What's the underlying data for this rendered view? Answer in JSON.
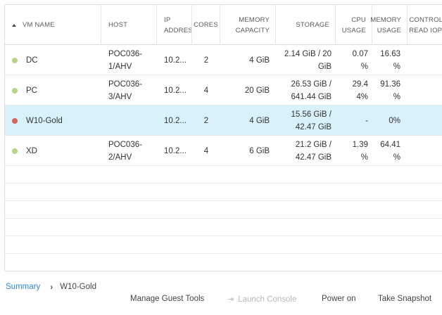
{
  "columns": {
    "vm_name": "VM NAME",
    "host": "HOST",
    "ip_1": "IP",
    "ip_2": "ADDRESS",
    "cores": "CORES",
    "memory_1": "MEMORY",
    "memory_2": "CAPACITY",
    "storage": "STORAGE",
    "cpu_1": "CPU",
    "cpu_2": "USAGE",
    "mem_usage_1": "MEMORY",
    "mem_usage_2": "USAGE",
    "ctrl_1": "CONTROLL",
    "ctrl_2": "READ IOPS"
  },
  "rows": [
    {
      "status_color": "#b5d38a",
      "name": "DC",
      "host_1": "POC036-",
      "host_2": "1/AHV",
      "ip": "10.2...",
      "cores": "2",
      "memory": "4 GiB",
      "storage_1": "2.14 GiB / 20",
      "storage_2": "GiB",
      "cpu_1": "0.07",
      "cpu_2": "%",
      "mem_1": "16.63",
      "mem_2": "%"
    },
    {
      "status_color": "#b5d38a",
      "name": "PC",
      "host_1": "POC036-",
      "host_2": "3/AHV",
      "ip": "10.2...",
      "cores": "4",
      "memory": "20 GiB",
      "storage_1": "26.53 GiB /",
      "storage_2": "641.44 GiB",
      "cpu_1": "29.4",
      "cpu_2": "4%",
      "mem_1": "91.36",
      "mem_2": "%"
    },
    {
      "status_color": "#d9625b",
      "name": "W10-Gold",
      "host_1": "",
      "host_2": "",
      "ip": "10.2...",
      "cores": "2",
      "memory": "4 GiB",
      "storage_1": "15.56 GiB /",
      "storage_2": "42.47 GiB",
      "cpu_1": "-",
      "cpu_2": "",
      "mem_1": "0%",
      "mem_2": ""
    },
    {
      "status_color": "#b5d38a",
      "name": "XD",
      "host_1": "POC036-",
      "host_2": "2/AHV",
      "ip": "10.2...",
      "cores": "4",
      "memory": "6 GiB",
      "storage_1": "21.2 GiB /",
      "storage_2": "42.47 GiB",
      "cpu_1": "1.39",
      "cpu_2": "%",
      "mem_1": "64.41",
      "mem_2": "%"
    }
  ],
  "selected_row": 2,
  "breadcrumb": {
    "root": "Summary",
    "separator": "›",
    "current": "W10-Gold"
  },
  "actions": {
    "manage_guest_tools": "Manage Guest Tools",
    "launch_console": "Launch Console",
    "launch_console_icon": "external-window-icon",
    "power_on": "Power on",
    "take_snapshot": "Take Snapshot"
  }
}
